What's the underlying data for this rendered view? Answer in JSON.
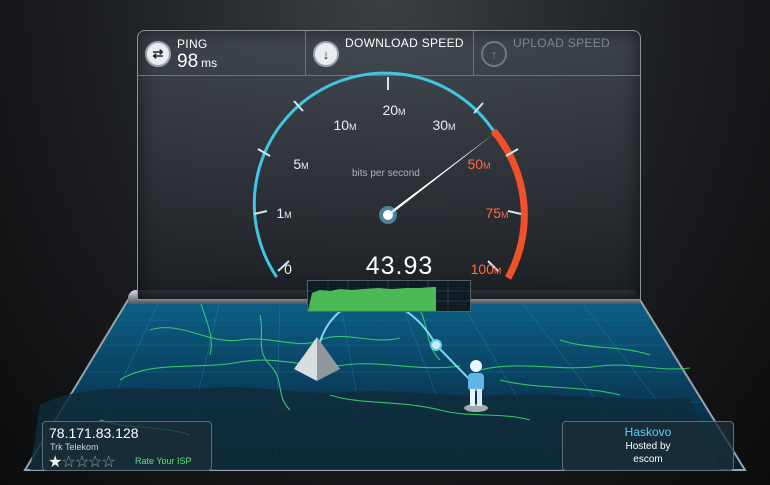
{
  "stats": {
    "ping": {
      "label": "PING",
      "value": "98",
      "unit": "ms",
      "icon": "ping-arrows-icon"
    },
    "download": {
      "label": "DOWNLOAD SPEED",
      "icon": "download-arrow-icon"
    },
    "upload": {
      "label": "UPLOAD SPEED",
      "icon": "upload-arrow-icon"
    }
  },
  "gauge": {
    "units_label": "bits per second",
    "readout": "43.93",
    "scale": [
      {
        "num": "0",
        "unit": ""
      },
      {
        "num": "1",
        "unit": "M"
      },
      {
        "num": "5",
        "unit": "M"
      },
      {
        "num": "10",
        "unit": "M"
      },
      {
        "num": "20",
        "unit": "M"
      },
      {
        "num": "30",
        "unit": "M"
      },
      {
        "num": "50",
        "unit": "M"
      },
      {
        "num": "75",
        "unit": "M"
      },
      {
        "num": "100",
        "unit": "M"
      }
    ]
  },
  "client": {
    "ip": "78.171.83.128",
    "isp": "Trk Telekom",
    "rating_stars_filled": 1,
    "rating_stars_total": 5,
    "rate_label": "Rate Your ISP"
  },
  "server": {
    "city": "Haskovo",
    "hosted_by": "Hosted by",
    "sponsor": "escom"
  },
  "colors": {
    "accent": "#3fc6e6",
    "red_zone": "#f0502a",
    "graph_fill": "#4fc25a",
    "rate_green": "#5ee37a"
  }
}
